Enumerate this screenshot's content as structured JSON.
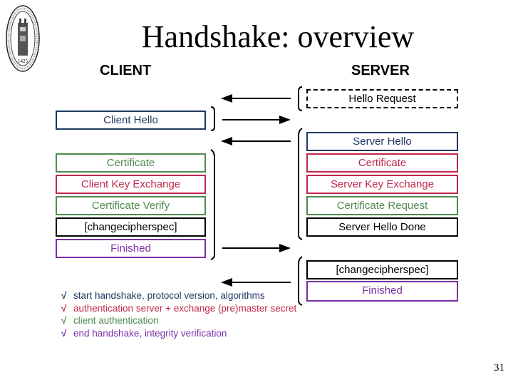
{
  "slide": {
    "title": "Handshake: overview",
    "page_number": "31",
    "logo": {
      "icon": "university-seal-icon",
      "year": "1425"
    }
  },
  "columns": {
    "client": "CLIENT",
    "server": "SERVER"
  },
  "colors": {
    "navy": "#1f3864",
    "green": "#4f8a4f",
    "red": "#c0284a",
    "black": "#000000",
    "purple": "#7a2fa8"
  },
  "messages": {
    "hello_request": "Hello Request",
    "client_hello": "Client Hello",
    "server_hello": "Server Hello",
    "server_certificate": "Certificate",
    "server_key_exchange": "Server Key Exchange",
    "certificate_request": "Certificate Request",
    "server_hello_done": "Server Hello Done",
    "client_certificate": "Certificate",
    "client_key_exchange": "Client Key Exchange",
    "certificate_verify": "Certificate Verify",
    "client_changecipherspec": "[changecipherspec]",
    "client_finished": "Finished",
    "server_changecipherspec": "[changecipherspec]",
    "server_finished": "Finished"
  },
  "flows": [
    {
      "from": "server",
      "to": "client",
      "group": "Hello Request"
    },
    {
      "from": "client",
      "to": "server",
      "group": "Client Hello"
    },
    {
      "from": "server",
      "to": "client",
      "group": "Server Hello ... Server Hello Done"
    },
    {
      "from": "client",
      "to": "server",
      "group": "Certificate ... Finished"
    },
    {
      "from": "server",
      "to": "client",
      "group": "[changecipherspec], Finished"
    }
  ],
  "legend": [
    {
      "mark": "√",
      "color": "navy",
      "text": "start handshake, protocol version, algorithms"
    },
    {
      "mark": "√",
      "color": "red",
      "text": "authentication server + exchange (pre)master secret"
    },
    {
      "mark": "√",
      "color": "green",
      "text": "client authentication"
    },
    {
      "mark": "√",
      "color": "purple",
      "text": "end handshake, integrity verification"
    }
  ]
}
